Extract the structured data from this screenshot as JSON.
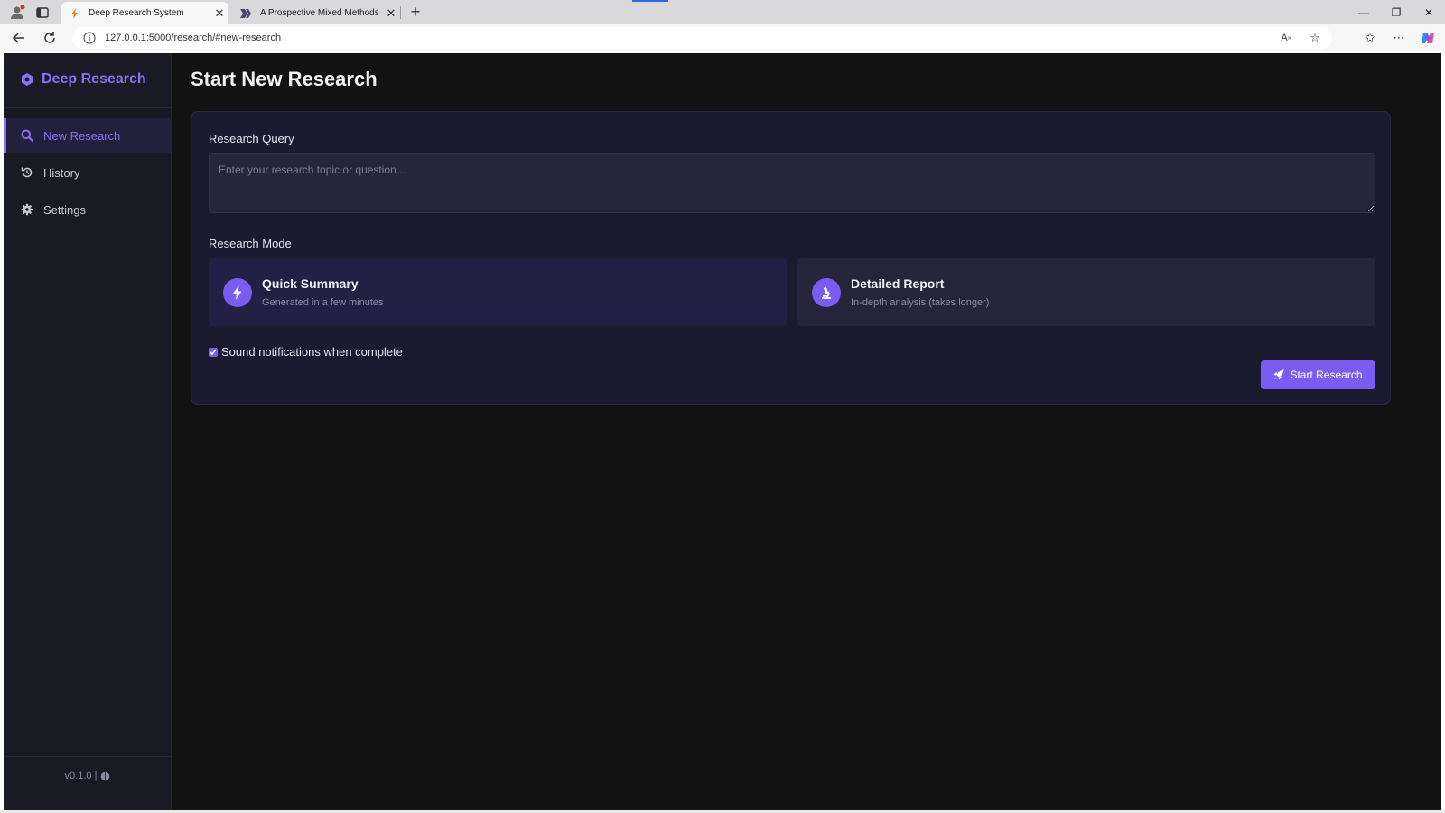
{
  "browser": {
    "tabs": [
      {
        "title": "Deep Research System",
        "active": true
      },
      {
        "title": "A Prospective Mixed Methods Stu",
        "active": false
      }
    ],
    "url": "127.0.0.1:5000/research/#new-research"
  },
  "sidebar": {
    "brand": "Deep Research",
    "items": [
      {
        "label": "New Research",
        "icon": "search-icon",
        "active": true
      },
      {
        "label": "History",
        "icon": "history-icon",
        "active": false
      },
      {
        "label": "Settings",
        "icon": "gear-icon",
        "active": false
      }
    ],
    "version": "v0.1.0 |"
  },
  "main": {
    "title": "Start New Research",
    "query_label": "Research Query",
    "query_placeholder": "Enter your research topic or question...",
    "query_value": "",
    "mode_label": "Research Mode",
    "modes": [
      {
        "title": "Quick Summary",
        "subtitle": "Generated in a few minutes",
        "icon": "bolt-icon",
        "selected": true
      },
      {
        "title": "Detailed Report",
        "subtitle": "In-depth analysis (takes longer)",
        "icon": "microscope-icon",
        "selected": false
      }
    ],
    "notification_label": "Sound notifications when complete",
    "notification_checked": true,
    "start_button": "Start Research"
  },
  "colors": {
    "accent": "#7b5cf0",
    "accent_text": "#8b6ff6",
    "background": "#121212",
    "sidebar": "#1a1a24",
    "card": "#1c1a2e"
  }
}
